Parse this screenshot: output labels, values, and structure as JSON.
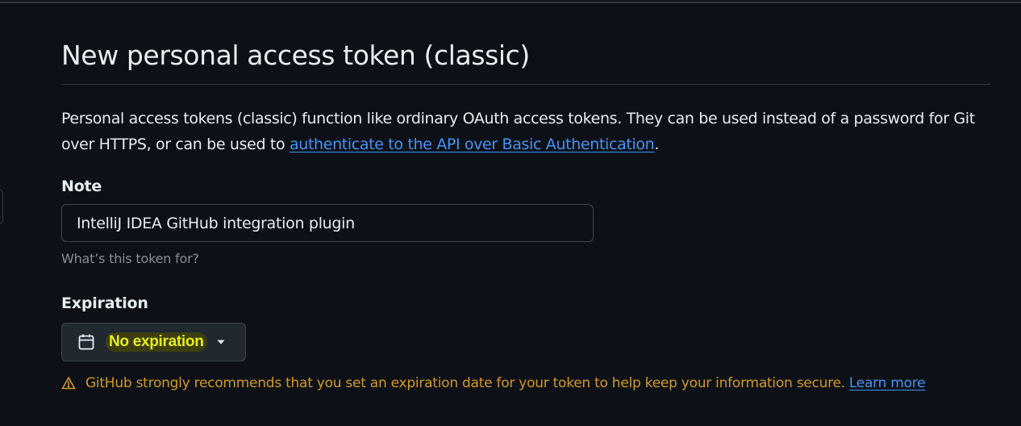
{
  "page": {
    "title": "New personal access token (classic)",
    "description_prefix": "Personal access tokens (classic) function like ordinary OAuth access tokens. They can be used instead of a password for Git over HTTPS, or can be used to ",
    "description_link": "authenticate to the API over Basic Authentication",
    "description_suffix": "."
  },
  "note": {
    "label": "Note",
    "value": "IntelliJ IDEA GitHub integration plugin",
    "hint": "What’s this token for?"
  },
  "expiration": {
    "label": "Expiration",
    "selected": "No expiration",
    "icon": "calendar-icon",
    "caret_icon": "triangle-down-icon",
    "warning": "GitHub strongly recommends that you set an expiration date for your token to help keep your information secure.",
    "warning_icon": "alert-icon",
    "learn_more": "Learn more"
  },
  "colors": {
    "background": "#0d1117",
    "text": "#e6edf3",
    "muted": "#848d97",
    "link": "#4493f8",
    "warning": "#d29922",
    "highlight_text": "#e6ed1a",
    "highlight_bg": "#3c3e10",
    "border": "#30363d"
  }
}
